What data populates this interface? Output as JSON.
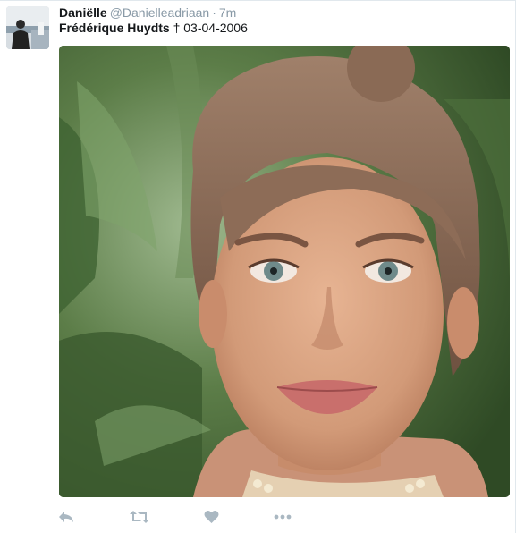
{
  "tweet": {
    "author_name": "Daniëlle",
    "handle": "@Danielleadriaan",
    "separator": "·",
    "timestamp": "7m",
    "text_bold": "Frédérique Huydts",
    "text_rest": " † 03-04-2006"
  },
  "media": {
    "description_icon": "photo-portrait"
  },
  "actions": {
    "reply_icon": "reply-icon",
    "retweet_icon": "retweet-icon",
    "like_icon": "heart-icon",
    "more_icon": "more-icon"
  },
  "colors": {
    "secondary_text": "#8899a6",
    "primary_text": "#14171a",
    "icon": "#aab8c2",
    "divider": "#e1e8ed"
  }
}
